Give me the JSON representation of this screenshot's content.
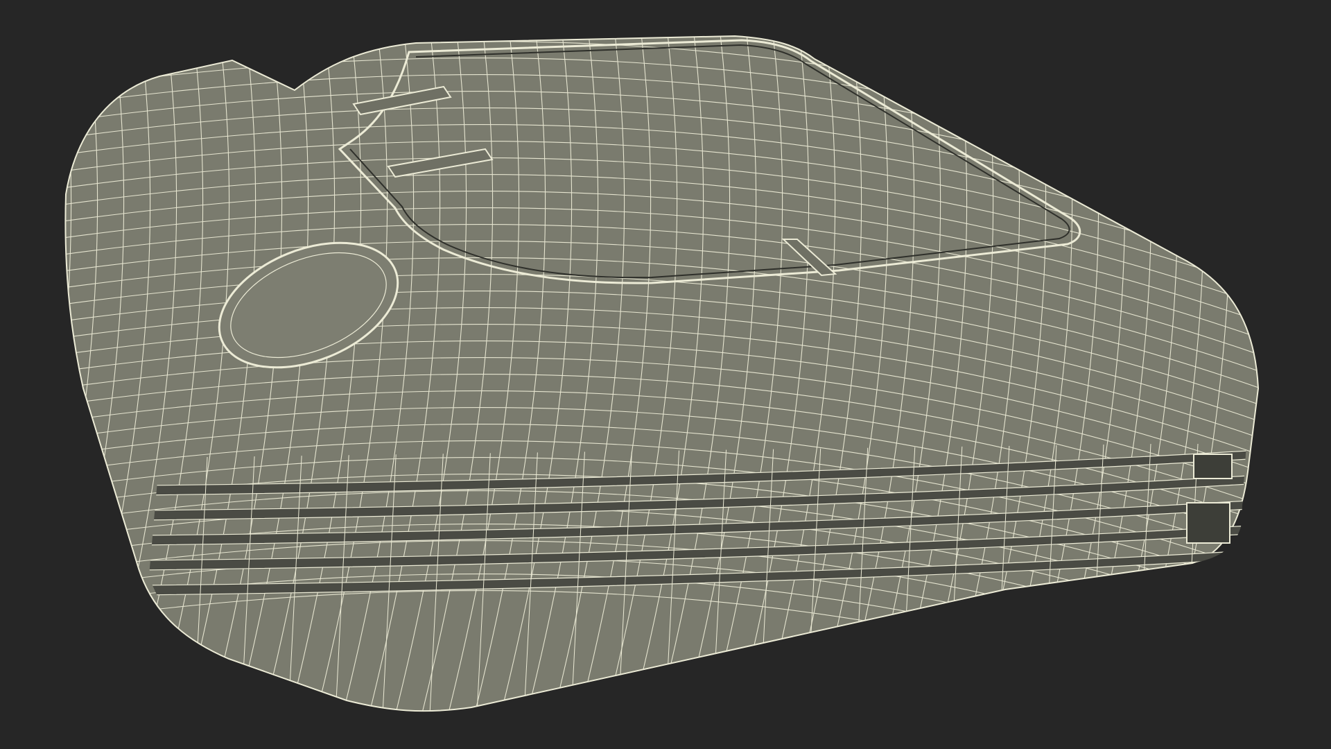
{
  "scene": {
    "background_color": "#262626",
    "model_fill": "#7a7b6e",
    "model_fill_dark": "#4a4b44",
    "wire_color": "#ecebd6",
    "subject": "wireframe-3d-model"
  }
}
